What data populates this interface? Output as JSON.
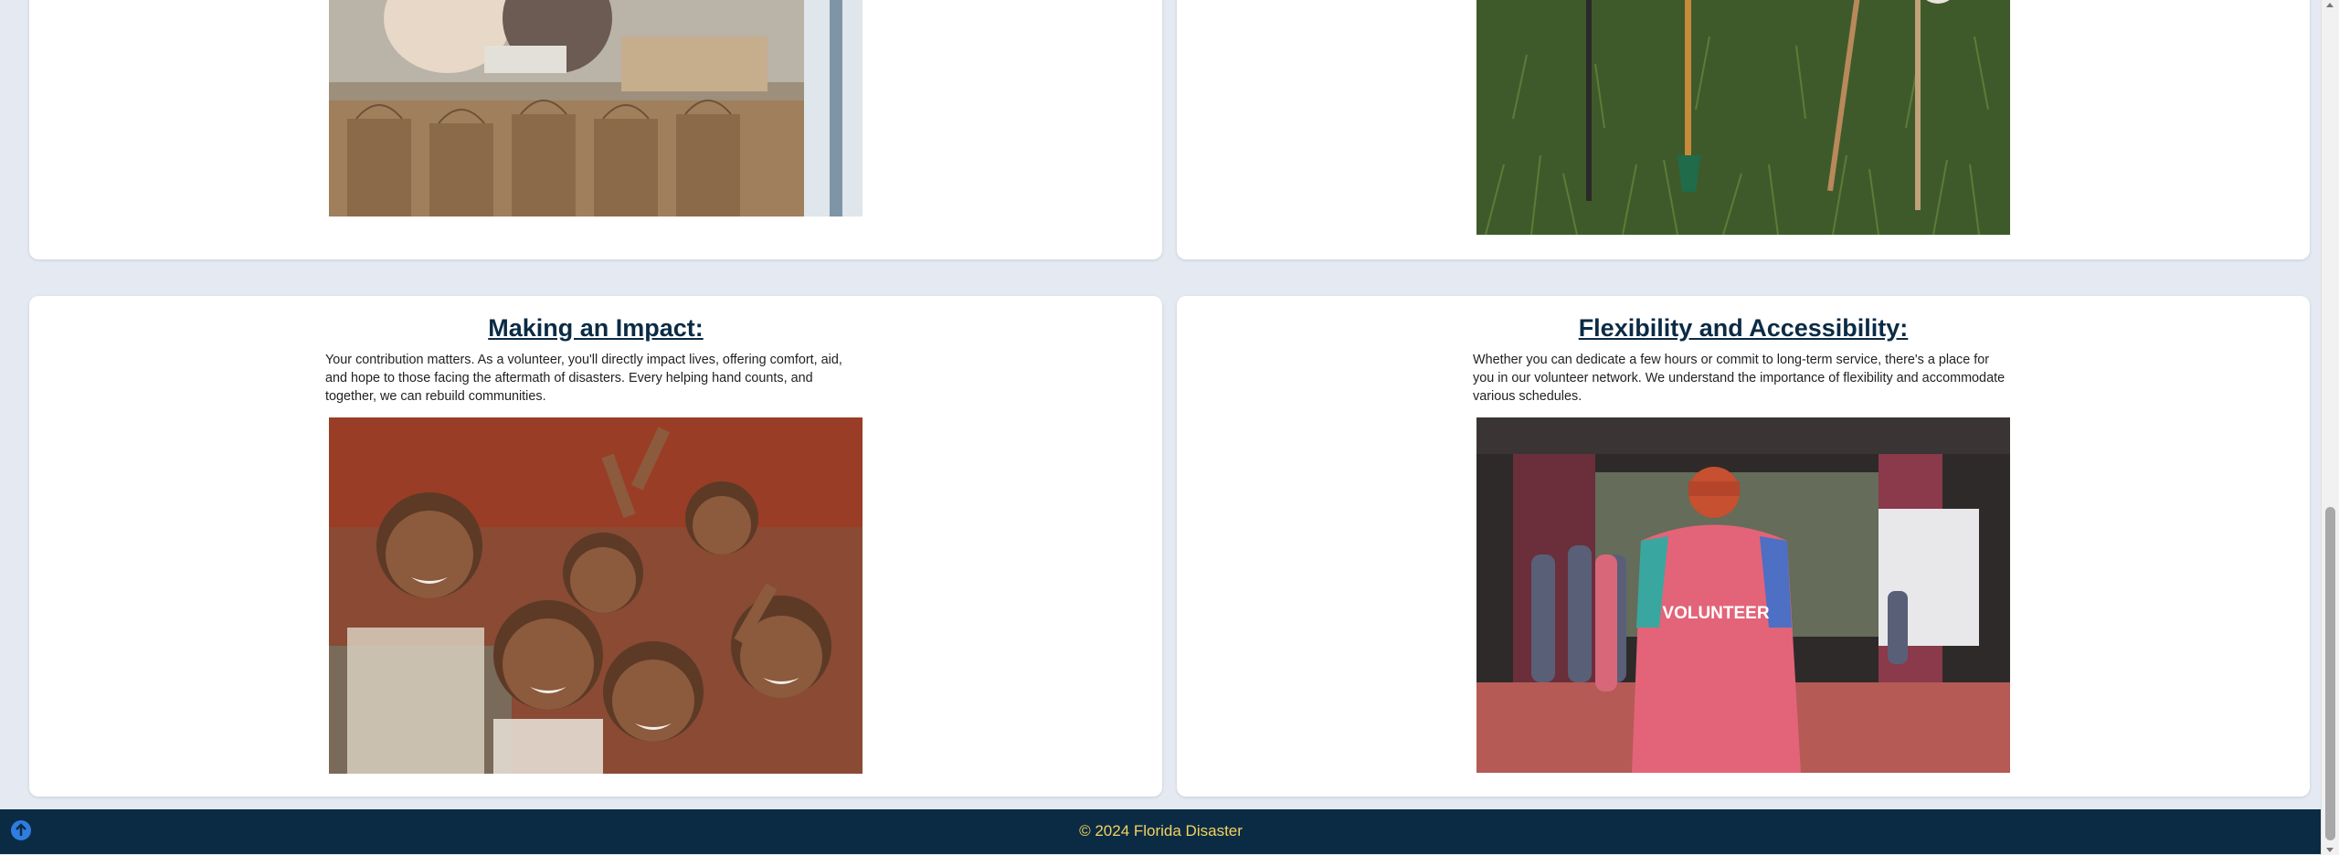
{
  "cards": [
    {
      "title": "",
      "text": "",
      "image_alt": "volunteers packing paper grocery bags"
    },
    {
      "title": "",
      "text": "",
      "image_alt": "shovels and rakes lying on green grass"
    },
    {
      "title": "Making an Impact:",
      "text": "Your contribution matters. As a volunteer, you'll directly impact lives, offering comfort, aid, and hope to those facing the aftermath of disasters. Every helping hand counts, and together, we can rebuild communities.",
      "image_alt": "smiling children making peace signs"
    },
    {
      "title": "Flexibility and Accessibility:",
      "text": "Whether you can dedicate a few hours or commit to long-term service, there's a place for you in our volunteer network. We understand the importance of flexibility and accommodate various schedules.",
      "image_alt": "volunteer in pink shirt and red cap at an event"
    }
  ],
  "footer": {
    "copyright": "© 2024 Florida Disaster",
    "back_to_top_icon": "arrow-up-circle-icon"
  },
  "colors": {
    "background": "#e4e9f2",
    "card": "#ffffff",
    "title": "#0b2b45",
    "footer_bg": "#0b2b45",
    "footer_text": "#f4d35e",
    "back_to_top": "#2f7de1"
  }
}
